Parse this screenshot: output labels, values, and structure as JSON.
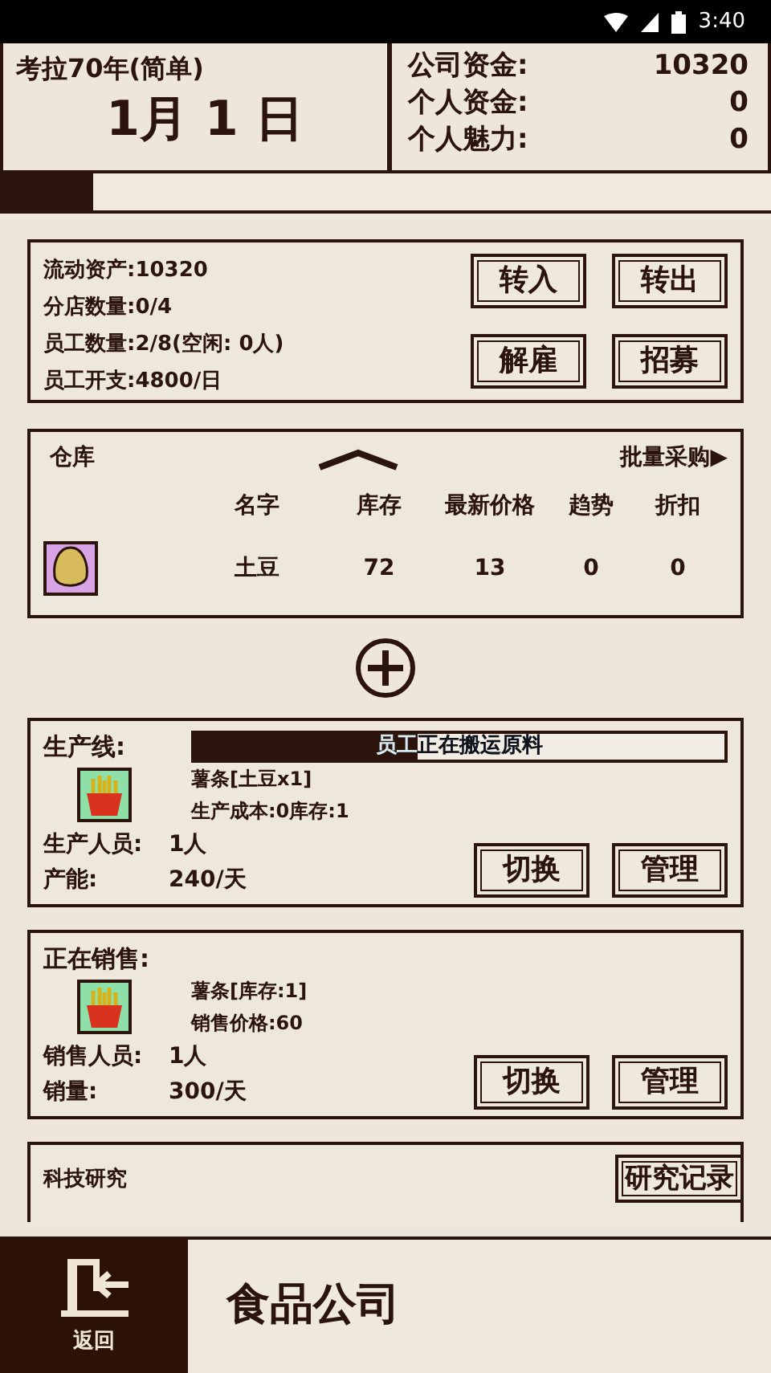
{
  "status_bar": {
    "time": "3:40"
  },
  "header": {
    "save_title": "考拉70年(简单)",
    "date": "1月 1 日",
    "stats": [
      {
        "label": "公司资金:",
        "value": "10320"
      },
      {
        "label": "个人资金:",
        "value": "0"
      },
      {
        "label": "个人魅力:",
        "value": "0"
      }
    ]
  },
  "day_progress": {
    "level": 0.12
  },
  "finance": {
    "lines": [
      "流动资产:10320",
      "分店数量:0/4",
      "员工数量:2/8(空闲: 0人)",
      "员工开支:4800/日"
    ],
    "buttons": [
      "转入",
      "转出",
      "解雇",
      "招募"
    ]
  },
  "warehouse": {
    "title": "仓库",
    "expanded": true,
    "bulk_buy": "批量采购▶",
    "columns": [
      "名字",
      "库存",
      "最新价格",
      "趋势",
      "折扣"
    ],
    "rows": [
      {
        "name": "土豆",
        "stock": "72",
        "price": "13",
        "trend": "0",
        "discount": "0"
      }
    ]
  },
  "production": {
    "title": "生产线:",
    "progress": {
      "level": 0.42,
      "text": "员工正在搬运原料"
    },
    "product": "薯条[土豆x1]",
    "detail": "生产成本:0库存:1",
    "stats": [
      {
        "label": "生产人员:",
        "value": "1人"
      },
      {
        "label": "产能:",
        "value": "240/天"
      }
    ],
    "buttons": [
      "切换",
      "管理"
    ]
  },
  "sales": {
    "title": "正在销售:",
    "product": "薯条[库存:1]",
    "detail": "销售价格:60",
    "stats": [
      {
        "label": "销售人员:",
        "value": "1人"
      },
      {
        "label": "销量:",
        "value": "300/天"
      }
    ],
    "buttons": [
      "切换",
      "管理"
    ]
  },
  "research": {
    "title": "科技研究",
    "button": "研究记录"
  },
  "bottom_bar": {
    "back": "返回",
    "title": "食品公司"
  }
}
